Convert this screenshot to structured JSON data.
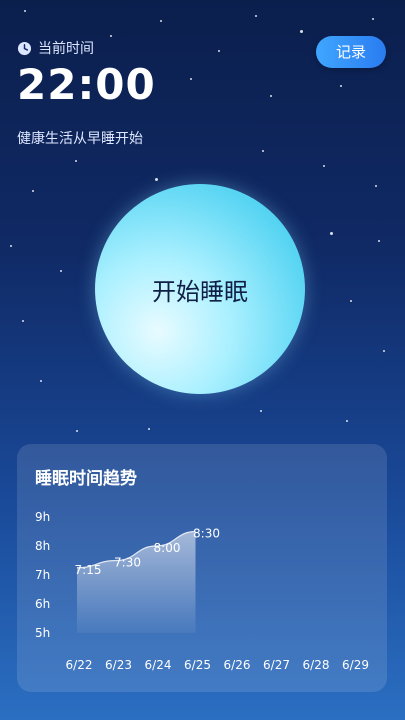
{
  "header": {
    "current_time_label": "当前时间",
    "time": "22:00",
    "subtitle": "健康生活从早睡开始",
    "record_button": "记录"
  },
  "main": {
    "start_sleep_label": "开始睡眠"
  },
  "chart_card": {
    "title": "睡眠时间趋势"
  },
  "chart_data": {
    "type": "area",
    "title": "睡眠时间趋势",
    "categories": [
      "6/22",
      "6/23",
      "6/24",
      "6/25",
      "6/26",
      "6/27",
      "6/28",
      "6/29"
    ],
    "y_ticks": [
      "9h",
      "8h",
      "7h",
      "6h",
      "5h"
    ],
    "ylim": [
      5,
      9
    ],
    "series": [
      {
        "values": [
          7.25,
          7.5,
          8.0,
          8.5,
          null,
          null,
          null,
          null
        ],
        "labels": [
          "7:15",
          "7:30",
          "8:00",
          "8:30",
          "",
          "",
          "",
          ""
        ]
      }
    ],
    "grid": false
  },
  "colors": {
    "accent": "#2a7cf0",
    "circle": "#59d5f3",
    "circle_text": "#0f1f45"
  }
}
